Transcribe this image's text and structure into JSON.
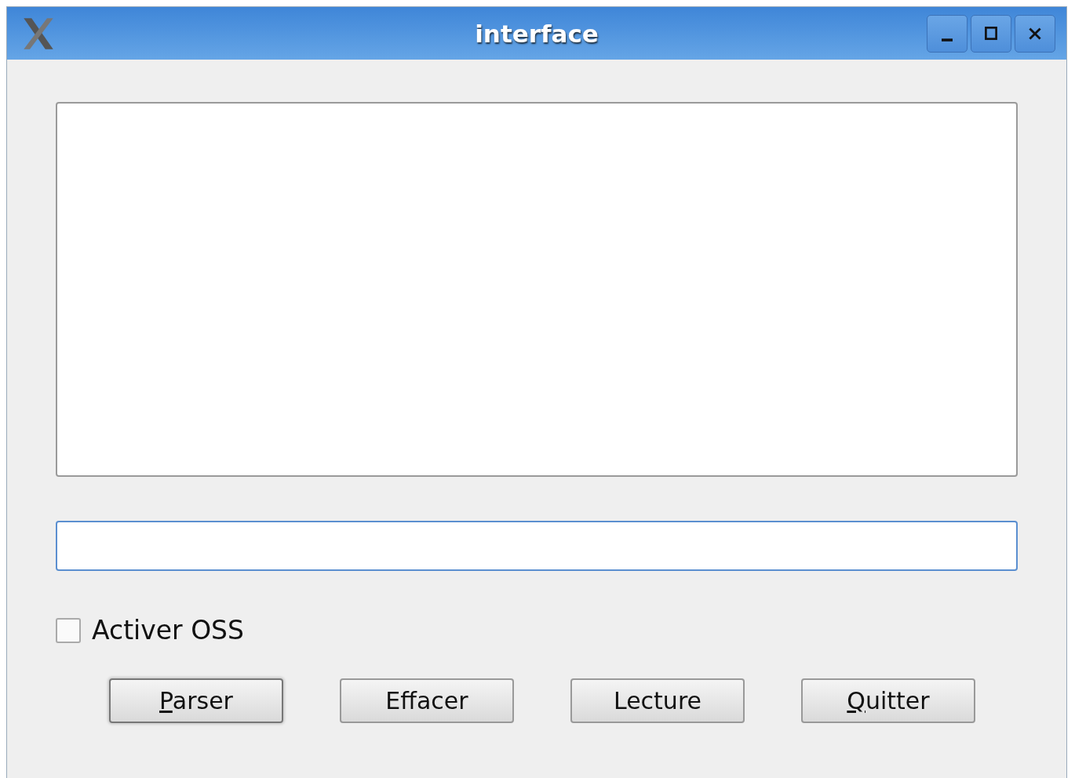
{
  "window": {
    "title": "interface"
  },
  "text_area": {
    "focused": false
  },
  "entry": {
    "focused": true
  },
  "checkbox": {
    "label": "Activer OSS",
    "checked": false
  },
  "buttons": [
    {
      "label": "Parser",
      "mnemonic": true,
      "focused": true
    },
    {
      "label": "Effacer",
      "mnemonic": false,
      "focused": false
    },
    {
      "label": "Lecture",
      "mnemonic": false,
      "focused": false
    },
    {
      "label": "Quitter",
      "mnemonic": true,
      "focused": false
    }
  ]
}
